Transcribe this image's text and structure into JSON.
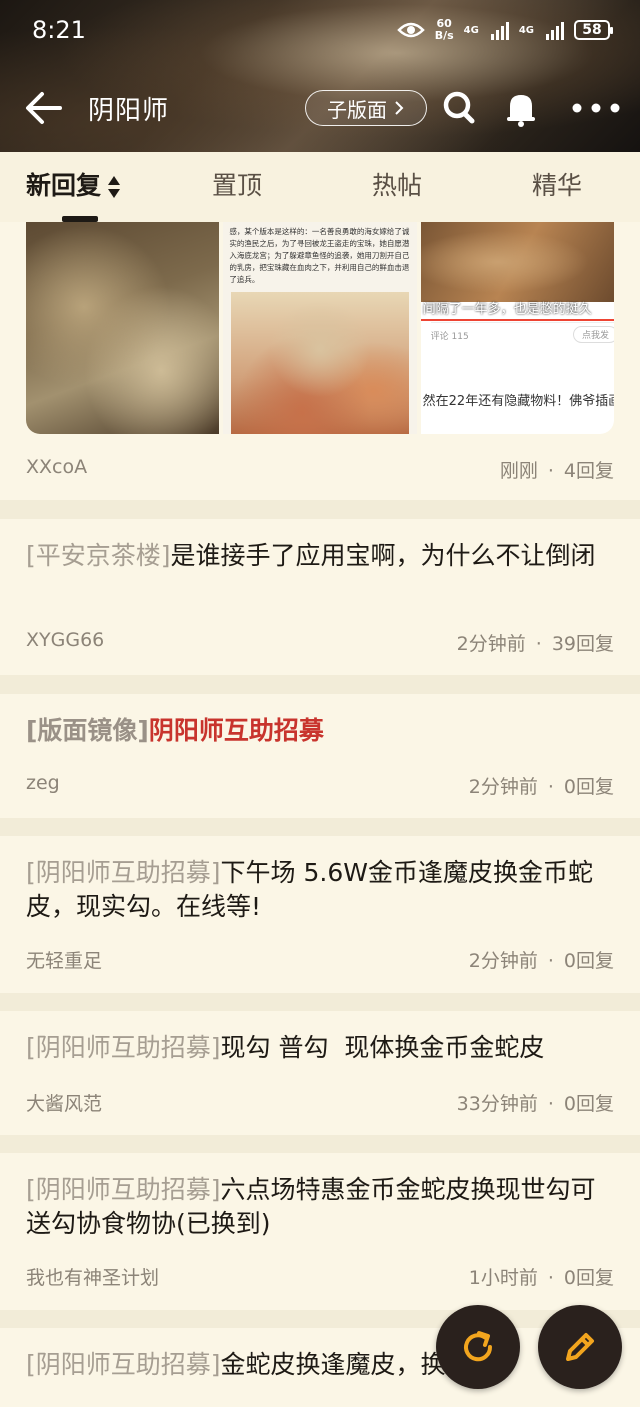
{
  "status_bar": {
    "time": "8:21",
    "net_speed_top": "60",
    "net_speed_bottom": "B/s",
    "network_1": "4G",
    "network_2": "4G",
    "battery": "58"
  },
  "nav": {
    "title": "阴阳师",
    "subforum_label": "子版面"
  },
  "tabs": [
    {
      "label": "新回复",
      "active": true
    },
    {
      "label": "置顶"
    },
    {
      "label": "热帖"
    },
    {
      "label": "精华"
    }
  ],
  "image_post": {
    "thumb2_caption": "感，某个版本是这样的：一名善良勇敢的海女嫁给了诚实的渔民之后，为了寻回被龙王盗走的宝珠，她自愿潜入海底龙宫；为了躲避章鱼怪的追袭，她用刀割开自己的乳房，把宝珠藏在血肉之下，并利用自己的鲜血击退了追兵。",
    "thumb3_overlay": "间隔了一年多，也是憋的挺久",
    "thumb3_comment": "评论 115",
    "thumb3_like": "点我发",
    "thumb3_bottom": "然在22年还有隐藏物料！佛爷插画",
    "author": "XXcoA",
    "time": "刚刚",
    "replies": "4回复"
  },
  "posts": [
    {
      "tag": "[平安京茶楼]",
      "title": "是谁接手了应用宝啊，为什么不让倒闭",
      "author": "XYGG66",
      "time": "2分钟前",
      "replies": "39回复"
    },
    {
      "tag": "[版面镜像]",
      "title": "阴阳师互助招募",
      "author": "zeg",
      "time": "2分钟前",
      "replies": "0回复"
    },
    {
      "tag": "[阴阳师互助招募]",
      "title": "下午场 5.6W金币逢魔皮换金币蛇皮，现实勾。在线等!",
      "author": "无轻重足",
      "time": "2分钟前",
      "replies": "0回复"
    },
    {
      "tag": "[阴阳师互助招募]",
      "title": "现勾 普勾  现体换金币金蛇皮",
      "author": "大酱风范",
      "time": "33分钟前",
      "replies": "0回复"
    },
    {
      "tag": "[阴阳师互助招募]",
      "title": "六点场特惠金币金蛇皮换现世勾可送勾协食物协(已换到)",
      "author": "我也有神圣计划",
      "time": "1小时前",
      "replies": "0回复"
    },
    {
      "tag": "[阴阳师互助招募]",
      "title": "金蛇皮换逢魔皮，换到"
    }
  ],
  "meta_separator": "·",
  "colors": {
    "background": "#f2ecd8",
    "card": "#fbf6e6",
    "title_text": "#1e1a15",
    "tag_text": "#a69e92",
    "red_title": "#c8342d",
    "fab_bg": "#2a211d",
    "fab_icon": "#f2a51e"
  },
  "icons": {
    "back": "arrow-left-icon",
    "search": "search-icon",
    "bell": "bell-icon",
    "more": "more-dots-icon",
    "refresh": "refresh-icon",
    "edit": "pencil-icon"
  }
}
